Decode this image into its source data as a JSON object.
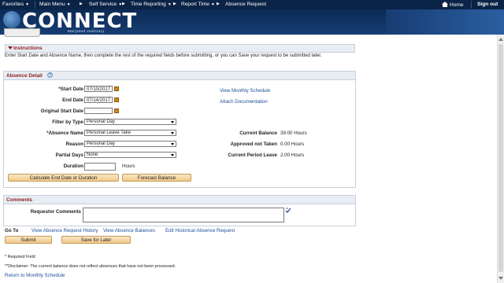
{
  "topnav": {
    "favorites": "Favorites",
    "main_menu": "Main Menu",
    "crumb1": "Self Service",
    "crumb2": "Time Reporting",
    "crumb3": "Report Time",
    "crumb4": "Absence Request",
    "home": "Home",
    "sign_out": "Sign out",
    "dropdown_glyph": "▼",
    "breadcrumb_glyph": "▶"
  },
  "header": {
    "logo_text": "CONNECT",
    "logo_sub": "Maryland Judiciary"
  },
  "instructions": {
    "title": "Instructions",
    "text": "Enter Start Date and Absence Name, then complete the rest of the required fields before submitting, or you can Save your request to be submitted later."
  },
  "absence_detail": {
    "title": "Absence Detail",
    "help_glyph": "?",
    "start_date_label": "*Start Date",
    "start_date": "07/10/2017",
    "end_date_label": "End Date",
    "end_date": "07/14/2017",
    "original_start_label": "Original Start Date",
    "original_start": "",
    "filter_label": "Filter by Type",
    "filter_value": "Personal Day",
    "absence_name_label": "*Absence Name",
    "absence_name_value": "Personal Leave Take",
    "reason_label": "Reason",
    "reason_value": "Personal Day",
    "partial_label": "Partial Days",
    "partial_value": "None",
    "duration_label": "Duration",
    "duration_value": "",
    "duration_unit": "Hours",
    "view_monthly": "View Monthly Schedule",
    "attach_doc": "Attach Documentation",
    "current_balance_label": "Current Balance",
    "current_balance": "39.00 Hours",
    "approved_not_taken_label": "Approved not Taken",
    "approved_not_taken": "0.00 Hours",
    "current_period_label": "Current Period Leave",
    "current_period": "2.00 Hours",
    "calc_button": "Calculate End Date or Duration",
    "forecast_button": "Forecast Balance"
  },
  "comments": {
    "title": "Comments",
    "requestor_label": "Requestor Comments",
    "requestor_value": ""
  },
  "goto": {
    "label": "Go To",
    "view_history": "View Absence Request History",
    "view_balances": "View Absence Balances",
    "edit_historical": "Edit Historical Absence Request"
  },
  "actions": {
    "submit": "Submit",
    "save_later": "Save for Later"
  },
  "footer": {
    "required_note": "* Required Field",
    "disclaimer": "**Disclaimer: The current balance does not reflect absences that have not been processed.",
    "return_link": "Return to Monthly Schedule"
  },
  "colors": {
    "nav_bg": "#0b2346",
    "section_title": "#8b1c1c",
    "link": "#1f4e9b",
    "button_bg": "#f1c98a"
  }
}
